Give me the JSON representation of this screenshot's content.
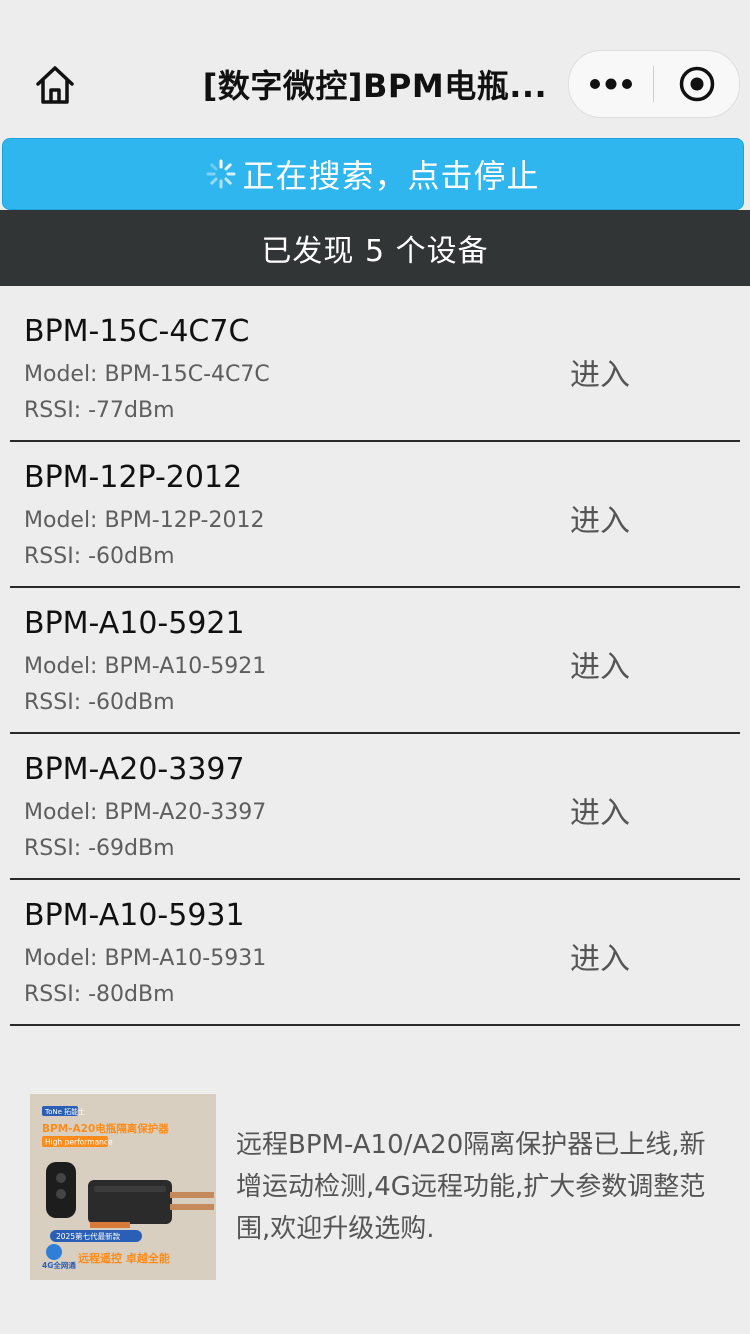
{
  "nav": {
    "title": "[数字微控]BPM电瓶...",
    "home_icon": "home-icon",
    "more_icon": "more-dots-icon",
    "close_icon": "target-close-icon"
  },
  "search": {
    "label": "正在搜索，点击停止",
    "color": "#2fb6ef"
  },
  "found": {
    "text": "已发现 5 个设备"
  },
  "devices": [
    {
      "name": "BPM-15C-4C7C",
      "model": "Model: BPM-15C-4C7C",
      "rssi": "RSSI: -77dBm",
      "action": "进入"
    },
    {
      "name": "BPM-12P-2012",
      "model": "Model: BPM-12P-2012",
      "rssi": "RSSI: -60dBm",
      "action": "进入"
    },
    {
      "name": "BPM-A10-5921",
      "model": "Model: BPM-A10-5921",
      "rssi": "RSSI: -60dBm",
      "action": "进入"
    },
    {
      "name": "BPM-A20-3397",
      "model": "Model: BPM-A20-3397",
      "rssi": "RSSI: -69dBm",
      "action": "进入"
    },
    {
      "name": "BPM-A10-5931",
      "model": "Model: BPM-A10-5931",
      "rssi": "RSSI: -80dBm",
      "action": "进入"
    }
  ],
  "promo": {
    "text": "远程BPM-A10/A20隔离保护器已上线,新增运动检测,4G远程功能,扩大参数调整范围,欢迎升级选购.",
    "image": {
      "brand": "ToNe 拓能士",
      "headline": "BPM-A20电瓶隔离保护器",
      "tag": "High performance",
      "badge": "2025第七代最新款",
      "network": "4G全网通",
      "slogan": "远程遥控 卓越全能"
    }
  }
}
